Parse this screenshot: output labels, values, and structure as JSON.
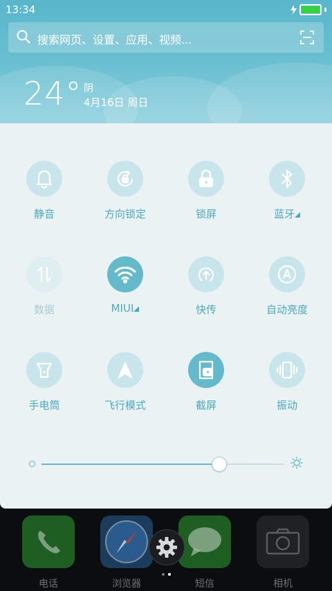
{
  "status_bar": {
    "time": "13:34",
    "battery_level": 1.0
  },
  "search": {
    "placeholder": "搜索网页、设置、应用、视频..."
  },
  "weather": {
    "temperature": "24°",
    "condition": "阴",
    "date": "4月16日 周日"
  },
  "toggles": [
    {
      "label": "静音",
      "icon": "bell-icon",
      "state": "off"
    },
    {
      "label": "方向锁定",
      "icon": "rotation-lock-icon",
      "state": "off"
    },
    {
      "label": "锁屏",
      "icon": "lock-icon",
      "state": "off"
    },
    {
      "label": "蓝牙",
      "icon": "bluetooth-icon",
      "state": "off",
      "has_menu": true
    },
    {
      "label": "数据",
      "icon": "data-arrows-icon",
      "state": "disabled"
    },
    {
      "label": "MIUI",
      "icon": "wifi-icon",
      "state": "on",
      "has_menu": true
    },
    {
      "label": "快传",
      "icon": "quick-transfer-icon",
      "state": "off"
    },
    {
      "label": "自动亮度",
      "icon": "auto-brightness-icon",
      "state": "off"
    },
    {
      "label": "手电筒",
      "icon": "flashlight-icon",
      "state": "off"
    },
    {
      "label": "飞行模式",
      "icon": "airplane-icon",
      "state": "off"
    },
    {
      "label": "截屏",
      "icon": "screenshot-icon",
      "state": "on"
    },
    {
      "label": "振动",
      "icon": "vibrate-icon",
      "state": "off"
    }
  ],
  "brightness": {
    "level": 0.73
  },
  "dock": {
    "apps": [
      {
        "label": "电话",
        "icon": "phone-icon",
        "color": "#2a8b2d"
      },
      {
        "label": "浏览器",
        "icon": "browser-compass-icon",
        "color": "#1b4f86"
      },
      {
        "label": "短信",
        "icon": "messages-icon",
        "color": "#2d8e30"
      },
      {
        "label": "相机",
        "icon": "camera-icon",
        "color": "#2d2e31"
      }
    ],
    "page_indicator": {
      "pages": 2,
      "current": 2
    }
  },
  "colors": {
    "accent": "#64b9ca",
    "label": "#4ea8bd",
    "panel_bg": "#eaf2f4",
    "header_bg": "#59b6cb"
  }
}
